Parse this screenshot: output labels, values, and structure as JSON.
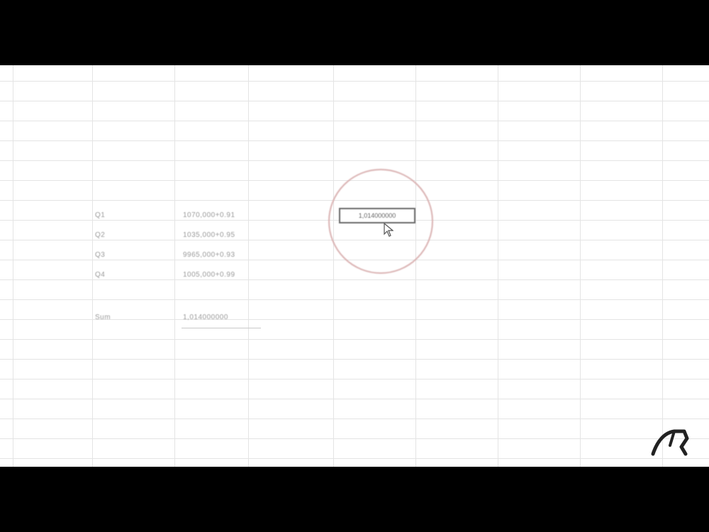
{
  "sheet": {
    "rows": [
      {
        "label": "Q1",
        "value": "1070,000+0.91"
      },
      {
        "label": "Q2",
        "value": "1035,000+0.95"
      },
      {
        "label": "Q3",
        "value": "9965,000+0.93"
      },
      {
        "label": "Q4",
        "value": "1005,000+0.99"
      }
    ],
    "total": {
      "label": "Sum",
      "value": "1,014000000"
    },
    "active_cell": {
      "value": "1,014000000"
    }
  },
  "colors": {
    "letterbox": "#000000",
    "gridline": "#e4e4e4",
    "highlight_circle": "#d9b0b0",
    "selected_cell_border": "#6a6a6a"
  },
  "icons": {
    "cursor": "mouse-pointer-icon",
    "watermark": "brand-logo-icon"
  }
}
